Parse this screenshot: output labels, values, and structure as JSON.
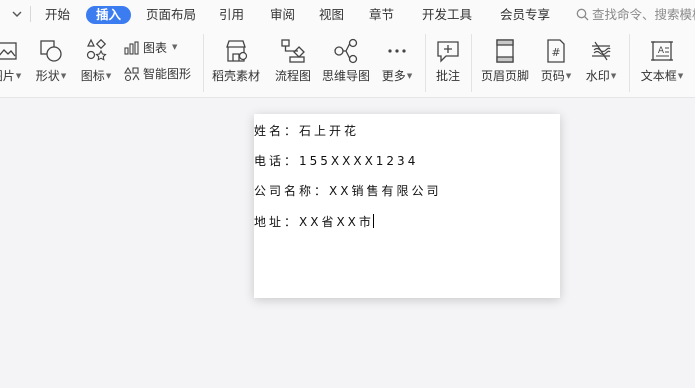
{
  "menubar": {
    "tabs": [
      {
        "label": "开始"
      },
      {
        "label": "插入"
      },
      {
        "label": "页面布局"
      },
      {
        "label": "引用"
      },
      {
        "label": "审阅"
      },
      {
        "label": "视图"
      },
      {
        "label": "章节"
      },
      {
        "label": "开发工具"
      },
      {
        "label": "会员专享"
      }
    ],
    "active_tab": "插入",
    "search_placeholder": "查找命令、搜索模板"
  },
  "ribbon": {
    "picture_label": "图片",
    "shape_label": "形状",
    "icon_label": "图标",
    "chart_label": "图表",
    "smartart_label": "智能图形",
    "material_label": "稻壳素材",
    "flowchart_label": "流程图",
    "mindmap_label": "思维导图",
    "more_label": "更多",
    "comment_label": "批注",
    "headerfooter_label": "页眉页脚",
    "pagenumber_label": "页码",
    "watermark_label": "水印",
    "textbox_label": "文本框"
  },
  "document": {
    "lines": [
      "姓名：石上开花",
      "电话：155XXXX1234",
      "公司名称：XX销售有限公司",
      "地址：XX省XX市"
    ]
  },
  "colors": {
    "accent": "#3b7cf0",
    "page_bg": "#f4f4f6",
    "toolbar_bg": "#fafafa"
  }
}
